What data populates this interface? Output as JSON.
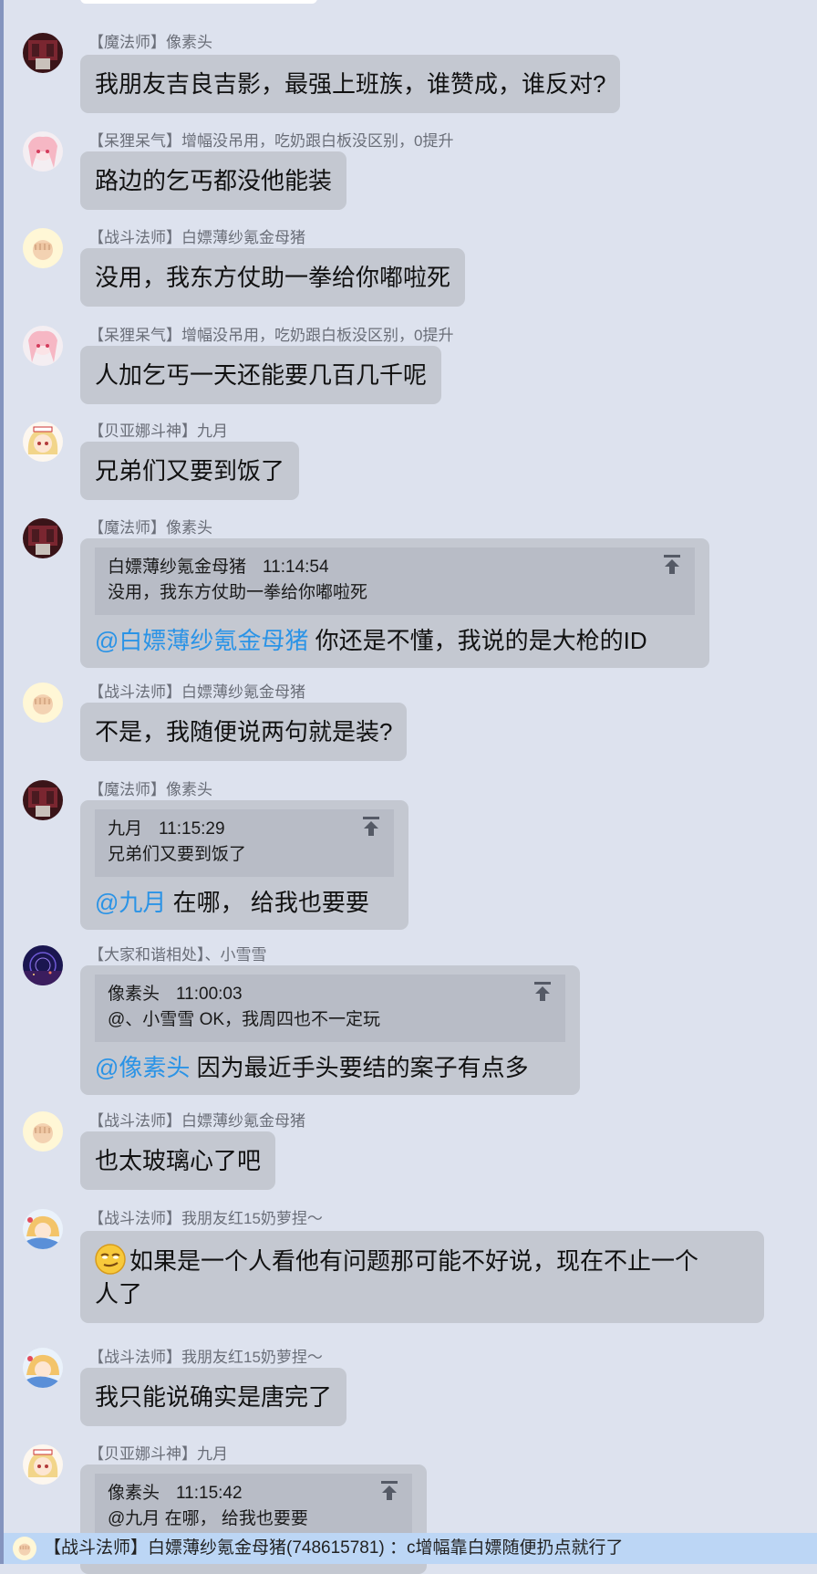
{
  "colors": {
    "background": "#dde2ee",
    "bubble": "#c4c8d1",
    "quote": "#b8bcc6",
    "mention": "#2a93e6",
    "notice_bar": "#bcd6f5"
  },
  "messages": [
    {
      "avatar": "avatar-wine",
      "sender": "【魔法师】像素头",
      "text": "我朋友吉良吉影，最强上班族，谁赞成，谁反对?"
    },
    {
      "avatar": "avatar-pink",
      "sender": "【呆狸呆气】增幅没吊用，吃奶跟白板没区别，0提升",
      "text": "路边的乞丐都没他能装"
    },
    {
      "avatar": "avatar-fist",
      "sender": "【战斗法师】白嫖薄纱氪金母猪",
      "text": "没用，我东方仗助一拳给你嘟啦死"
    },
    {
      "avatar": "avatar-pink",
      "sender": "【呆狸呆气】增幅没吊用，吃奶跟白板没区别，0提升",
      "text": "人加乞丐一天还能要几百几千呢"
    },
    {
      "avatar": "avatar-girl",
      "sender": "【贝亚娜斗神】九月",
      "text": "兄弟们又要到饭了"
    },
    {
      "avatar": "avatar-wine",
      "sender": "【魔法师】像素头",
      "quote": {
        "name": "白嫖薄纱氪金母猪",
        "time": "11:14:54",
        "text": "没用，我东方仗助一拳给你嘟啦死"
      },
      "mention": "@白嫖薄纱氪金母猪",
      "text": " 你还是不懂，我说的是大枪的ID"
    },
    {
      "avatar": "avatar-fist",
      "sender": "【战斗法师】白嫖薄纱氪金母猪",
      "text": "不是，我随便说两句就是装?"
    },
    {
      "avatar": "avatar-wine",
      "sender": "【魔法师】像素头",
      "quote": {
        "name": "九月",
        "time": "11:15:29",
        "text": "兄弟们又要到饭了"
      },
      "mention": "@九月",
      "text": " 在哪， 给我也要要"
    },
    {
      "avatar": "avatar-night",
      "sender": "【大家和谐相处】、小雪雪",
      "quote": {
        "name": "像素头",
        "time": "11:00:03",
        "text": "@、小雪雪 OK，我周四也不一定玩"
      },
      "mention": "@像素头",
      "text": " 因为最近手头要结的案子有点多"
    },
    {
      "avatar": "avatar-fist",
      "sender": "【战斗法师】白嫖薄纱氪金母猪",
      "text": "也太玻璃心了吧"
    },
    {
      "avatar": "avatar-anime",
      "sender": "【战斗法师】我朋友红15奶萝捏～",
      "emoji": "smirk-emoji",
      "text": "如果是一个人看他有问题那可能不好说，现在不止一个",
      "text2": "人了"
    },
    {
      "avatar": "avatar-anime",
      "sender": "【战斗法师】我朋友红15奶萝捏～",
      "text": "我只能说确实是唐完了"
    },
    {
      "avatar": "avatar-girl",
      "sender": "【贝亚娜斗神】九月",
      "quote": {
        "name": "像素头",
        "time": "11:15:42",
        "text": "@九月 在哪， 给我也要要"
      }
    }
  ],
  "notice": {
    "avatar": "avatar-fist",
    "text": "【战斗法师】白嫖薄纱氪金母猪(748615781) ：c增幅靠白嫖随便扔点就行了"
  }
}
